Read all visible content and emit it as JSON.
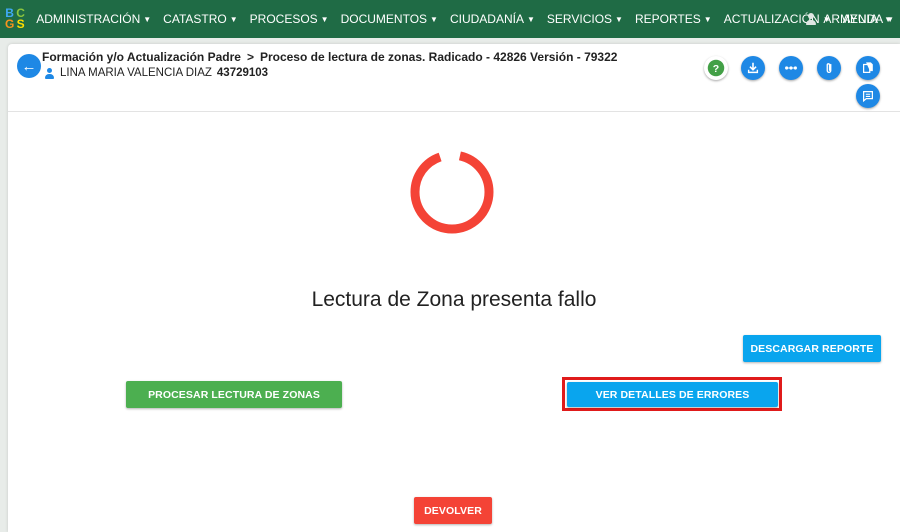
{
  "nav": {
    "logo_letters": [
      "B",
      "C",
      "G",
      "S"
    ],
    "items": [
      {
        "label": "ADMINISTRACIÓN"
      },
      {
        "label": "CATASTRO"
      },
      {
        "label": "PROCESOS"
      },
      {
        "label": "DOCUMENTOS"
      },
      {
        "label": "CIUDADANÍA"
      },
      {
        "label": "SERVICIOS"
      },
      {
        "label": "REPORTES"
      },
      {
        "label": "ACTUALIZACIÓN"
      },
      {
        "label": "AYUDA"
      }
    ],
    "user": "ARMENIA"
  },
  "header": {
    "breadcrumb_parent": "Formación y/o Actualización Padre",
    "separator": ">",
    "breadcrumb_current": "Proceso de lectura de zonas. Radicado - 42826 Versión - 79322",
    "person_name": "LINA MARIA VALENCIA DIAZ",
    "person_id": "43729103"
  },
  "actions": {
    "help": "help-icon",
    "download": "download-icon",
    "flow": "flow-icon",
    "attach": "paperclip-icon",
    "copy": "copy-icon",
    "comments": "comment-icon"
  },
  "main": {
    "status_title": "Lectura de Zona presenta fallo",
    "download_report": "DESCARGAR REPORTE",
    "process_zones": "PROCESAR LECTURA DE ZONAS",
    "view_errors": "VER DETALLES DE ERRORES",
    "return": "DEVOLVER"
  },
  "colors": {
    "nav_bg": "#1f6b45",
    "primary_blue": "#09a5ee",
    "green": "#4caf50",
    "red": "#f44336",
    "highlight": "#e01b1b"
  }
}
